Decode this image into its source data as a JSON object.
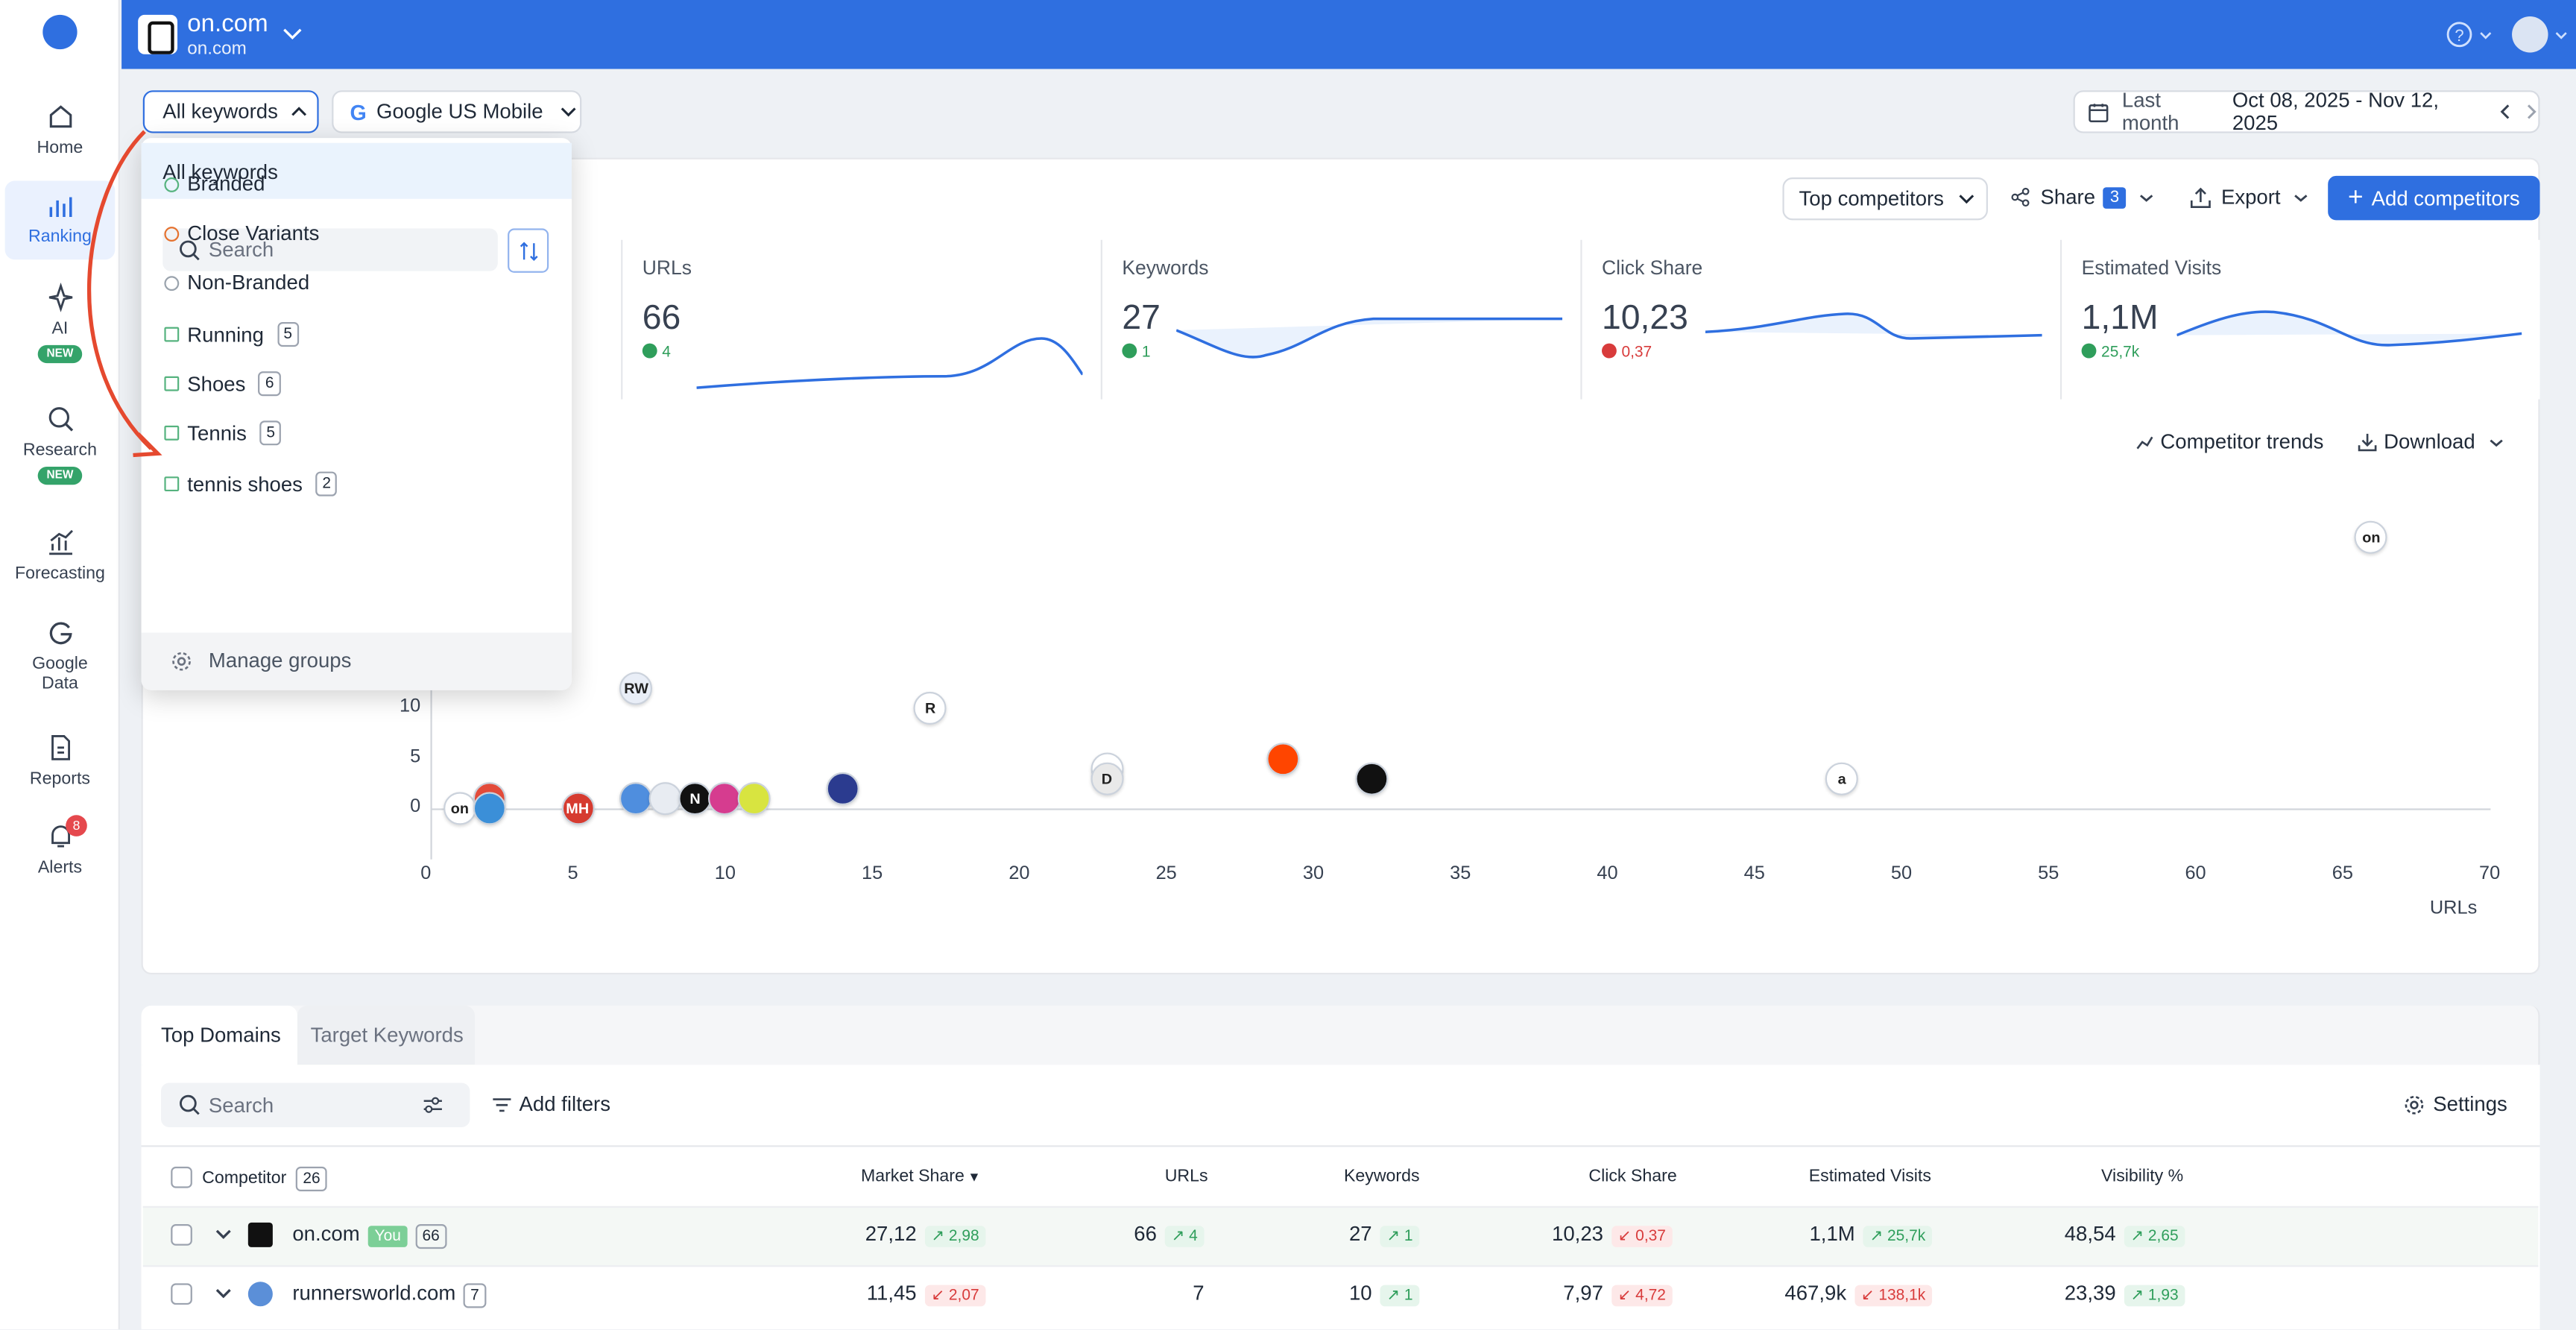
{
  "header": {
    "project_name": "on.com",
    "project_domain": "on.com"
  },
  "sidebar": {
    "items": [
      {
        "label": "Home"
      },
      {
        "label": "Ranking"
      },
      {
        "label": "AI",
        "badge": "NEW"
      },
      {
        "label": "Research",
        "badge": "NEW"
      },
      {
        "label": "Forecasting"
      },
      {
        "label": "Google",
        "label2": "Data"
      },
      {
        "label": "Reports"
      },
      {
        "label": "Alerts",
        "count": "8"
      }
    ]
  },
  "filters": {
    "keywords_label": "All keywords",
    "engine_label": "Google US Mobile",
    "period_label": "Last month",
    "date_range": "Oct 08, 2025 - Nov 12, 2025"
  },
  "toolbar": {
    "competitors_label": "Top competitors",
    "share_label": "Share",
    "share_count": "3",
    "export_label": "Export",
    "add_label": "Add competitors"
  },
  "metrics": [
    {
      "label": "URLs",
      "value": "66",
      "delta": "4",
      "dir": "up"
    },
    {
      "label": "Keywords",
      "value": "27",
      "delta": "1",
      "dir": "up"
    },
    {
      "label": "Click Share",
      "value": "10,23",
      "delta": "0,37",
      "dir": "down"
    },
    {
      "label": "Estimated Visits",
      "value": "1,1M",
      "delta": "25,7k",
      "dir": "up"
    }
  ],
  "chart_actions": {
    "trends": "Competitor trends",
    "download": "Download"
  },
  "chart_data": {
    "type": "scatter",
    "xlabel": "URLs",
    "x_ticks": [
      "0",
      "5",
      "10",
      "15",
      "20",
      "25",
      "30",
      "35",
      "40",
      "45",
      "50",
      "55",
      "60",
      "65",
      "70"
    ],
    "y_ticks": [
      "0",
      "5",
      "10"
    ],
    "xlim": [
      0,
      70
    ],
    "points": [
      {
        "x": 1,
        "y": 0,
        "label": "on"
      },
      {
        "x": 2,
        "y": 1,
        "label": ""
      },
      {
        "x": 2,
        "y": 0,
        "label": ""
      },
      {
        "x": 5,
        "y": 0,
        "label": "MH"
      },
      {
        "x": 7,
        "y": 12,
        "label": "RW"
      },
      {
        "x": 7,
        "y": 1,
        "label": ""
      },
      {
        "x": 8,
        "y": 1,
        "label": ""
      },
      {
        "x": 9,
        "y": 1,
        "label": "N"
      },
      {
        "x": 10,
        "y": 1,
        "label": ""
      },
      {
        "x": 11,
        "y": 1,
        "label": ""
      },
      {
        "x": 14,
        "y": 2,
        "label": ""
      },
      {
        "x": 17,
        "y": 10,
        "label": "R"
      },
      {
        "x": 23,
        "y": 4,
        "label": ""
      },
      {
        "x": 23,
        "y": 3,
        "label": "D"
      },
      {
        "x": 29,
        "y": 5,
        "label": ""
      },
      {
        "x": 32,
        "y": 3,
        "label": ""
      },
      {
        "x": 48,
        "y": 3,
        "label": "a"
      },
      {
        "x": 66,
        "y": 27,
        "label": "on"
      }
    ]
  },
  "dropdown": {
    "header": "All keywords",
    "search_placeholder": "Search",
    "items": [
      {
        "label": "Branded",
        "count": ""
      },
      {
        "label": "Close Variants",
        "count": ""
      },
      {
        "label": "Non-Branded",
        "count": ""
      },
      {
        "label": "Running",
        "count": "5"
      },
      {
        "label": "Shoes",
        "count": "6"
      },
      {
        "label": "Tennis",
        "count": "5"
      },
      {
        "label": "tennis shoes",
        "count": "2"
      }
    ],
    "manage": "Manage groups"
  },
  "tabs": {
    "top_domains": "Top Domains",
    "target_keywords": "Target Keywords"
  },
  "table_tools": {
    "search_placeholder": "Search",
    "add_filters": "Add filters",
    "settings": "Settings"
  },
  "table": {
    "competitor_header": "Competitor",
    "competitor_count": "26",
    "headers": [
      "Market Share",
      "URLs",
      "Keywords",
      "Click Share",
      "Estimated Visits",
      "Visibility %"
    ],
    "rows": [
      {
        "domain": "on.com",
        "you": "You",
        "count": "66",
        "market": "27,12",
        "market_d": "2,98",
        "market_dir": "up",
        "urls": "66",
        "urls_d": "4",
        "urls_dir": "up",
        "kw": "27",
        "kw_d": "1",
        "kw_dir": "up",
        "click": "10,23",
        "click_d": "0,37",
        "click_dir": "down",
        "visits": "1,1M",
        "visits_d": "25,7k",
        "visits_dir": "up",
        "vis": "48,54",
        "vis_d": "2,65",
        "vis_dir": "up"
      },
      {
        "domain": "runnersworld.com",
        "you": "",
        "count": "7",
        "market": "11,45",
        "market_d": "2,07",
        "market_dir": "down",
        "urls": "7",
        "urls_d": "",
        "urls_dir": "",
        "kw": "10",
        "kw_d": "1",
        "kw_dir": "up",
        "click": "7,97",
        "click_d": "4,72",
        "click_dir": "down",
        "visits": "467,9k",
        "visits_d": "138,1k",
        "visits_dir": "down",
        "vis": "23,39",
        "vis_d": "1,93",
        "vis_dir": "up"
      }
    ]
  }
}
